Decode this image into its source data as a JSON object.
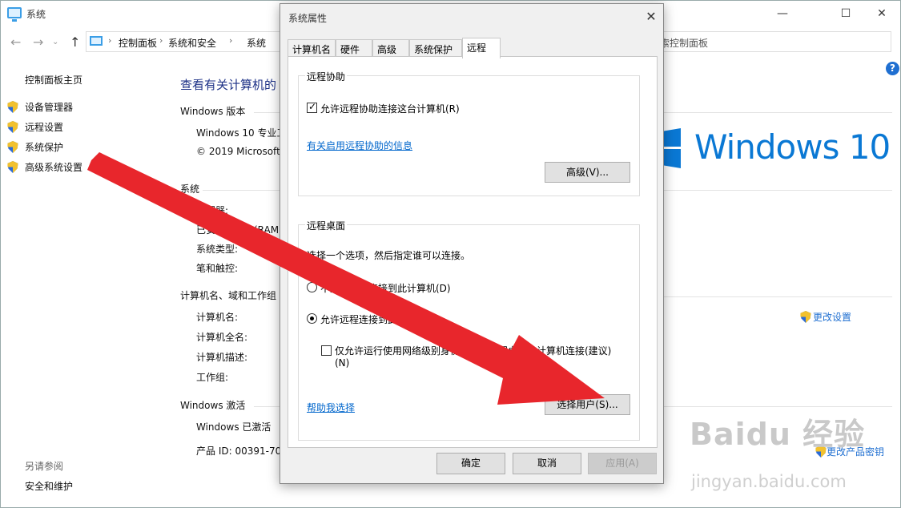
{
  "window": {
    "title": "系统",
    "minimize": "—",
    "maximize": "☐",
    "close": "✕"
  },
  "address": {
    "breadcrumbs": [
      "控制面板",
      "系统和安全",
      "系统"
    ],
    "search_placeholder": "索控制面板"
  },
  "left_nav": {
    "home": "控制面板主页",
    "items": [
      "设备管理器",
      "远程设置",
      "系统保护",
      "高级系统设置"
    ],
    "see_also": "另请参阅",
    "security_maintenance": "安全和维护"
  },
  "main": {
    "heading": "查看有关计算机的",
    "windows_edition_title": "Windows 版本",
    "edition": "Windows 10 专业工",
    "copyright": "© 2019 Microsoft",
    "system_title": "系统",
    "system_rows": [
      "处理器:",
      "已安装的内存(RAM)",
      "系统类型:",
      "笔和触控:"
    ],
    "computer_title": "计算机名、域和工作组",
    "computer_rows": [
      "计算机名:",
      "计算机全名:",
      "计算机描述:",
      "工作组:"
    ],
    "activation_title": "Windows 激活",
    "activated": "Windows 已激活",
    "product_id": "产品 ID: 00391-700",
    "change_settings": "更改设置",
    "change_key": "更改产品密钥",
    "logo_text": "Windows 10"
  },
  "watermark": {
    "brand": "Baidu 经验",
    "url": "jingyan.baidu.com"
  },
  "dialog": {
    "title": "系统属性",
    "close": "✕",
    "tabs": [
      "计算机名",
      "硬件",
      "高级",
      "系统保护",
      "远程"
    ],
    "active_tab": "远程",
    "remote_assistance": {
      "group": "远程协助",
      "allow_label": "允许远程协助连接这台计算机(R)",
      "allow_checked": true,
      "info_link": "有关启用远程协助的信息",
      "advanced_button": "高级(V)..."
    },
    "remote_desktop": {
      "group": "远程桌面",
      "instruction": "选择一个选项，然后指定谁可以连接。",
      "option_deny": "不允许远程连接到此计算机(D)",
      "option_allow": "允许远程连接到此计算机(L)",
      "selected": "allow",
      "nla_label": "仅允许运行使用网络级别身份验证的远程桌面的计算机连接(建议)",
      "nla_suffix": "(N)",
      "nla_checked": false,
      "help_link": "帮助我选择",
      "select_users_button": "选择用户(S)..."
    },
    "buttons": {
      "ok": "确定",
      "cancel": "取消",
      "apply": "应用(A)"
    }
  },
  "colors": {
    "accent_blue": "#0a78d4",
    "link_blue": "#0066cc",
    "arrow_red": "#e8262c"
  }
}
